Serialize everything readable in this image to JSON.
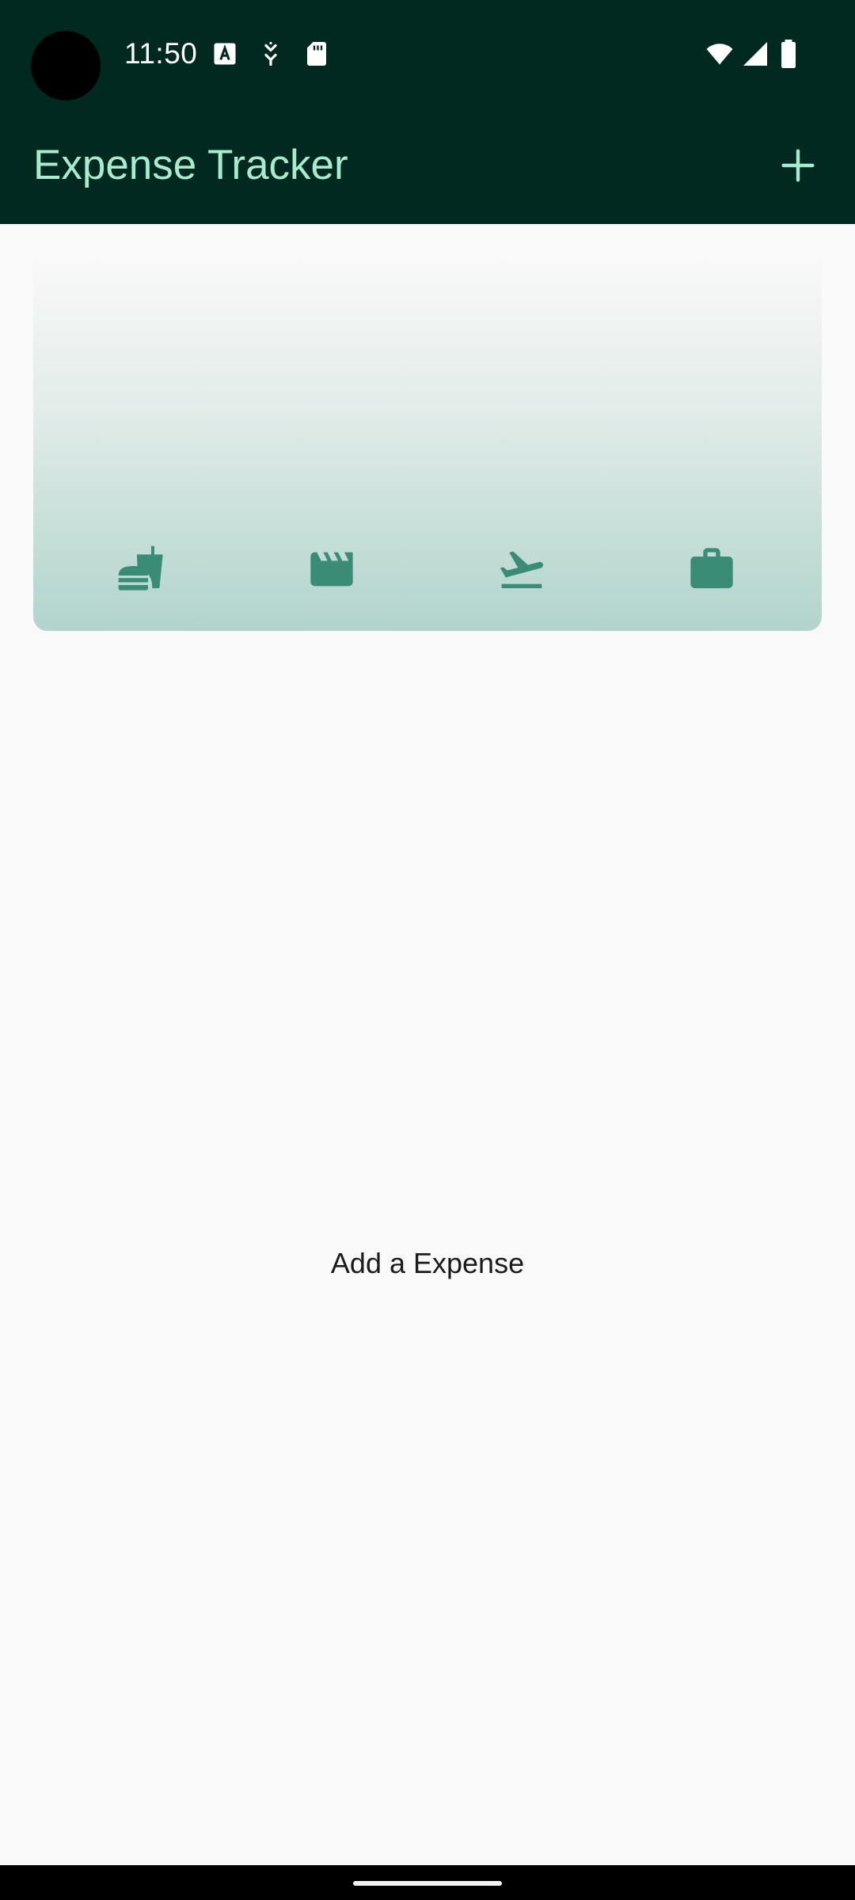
{
  "status_bar": {
    "time": "11:50",
    "left_icons": [
      "keyboard-a-icon",
      "download-status-icon",
      "sd-card-icon"
    ],
    "right_icons": [
      "wifi-icon",
      "cellular-signal-icon",
      "battery-icon"
    ]
  },
  "app_bar": {
    "title": "Expense Tracker",
    "add_icon": "plus-icon"
  },
  "chart": {
    "categories": [
      {
        "name": "food",
        "icon": "fastfood-icon"
      },
      {
        "name": "leisure",
        "icon": "movie-icon"
      },
      {
        "name": "travel",
        "icon": "flight-takeoff-icon"
      },
      {
        "name": "work",
        "icon": "work-icon"
      }
    ],
    "fill_fractions": [
      0,
      0,
      0,
      0
    ]
  },
  "main": {
    "empty_message": "Add a Expense"
  },
  "colors": {
    "app_bar_bg": "#012920",
    "title_color": "#a8ecd0",
    "accent": "#3a8c77",
    "page_bg": "#f9f9f9"
  }
}
